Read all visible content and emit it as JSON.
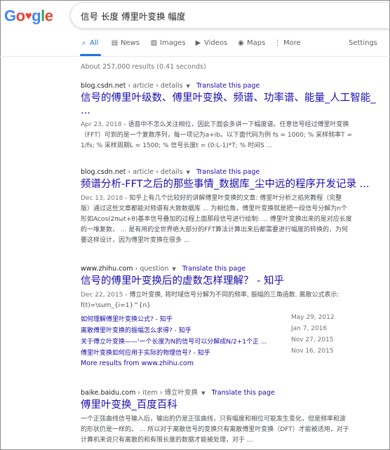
{
  "logo": {
    "text": "Google",
    "letters": [
      "G",
      "o",
      "o",
      "g",
      "l",
      "e"
    ]
  },
  "search": {
    "query": "信号 长度 傅里叶变换 幅度"
  },
  "tabs": [
    {
      "label": "All",
      "icon": "search-icon",
      "active": true
    },
    {
      "label": "News",
      "icon": "news-icon",
      "active": false
    },
    {
      "label": "Images",
      "icon": "image-icon",
      "active": false
    },
    {
      "label": "Videos",
      "icon": "video-icon",
      "active": false
    },
    {
      "label": "Maps",
      "icon": "map-pin-icon",
      "active": false
    },
    {
      "label": "More",
      "icon": "more-dots-icon",
      "active": false
    }
  ],
  "settings_label": "Settings",
  "result_stats": "About 257,000 results (0.41 seconds)",
  "results": [
    {
      "domain": "blog.csdn.net",
      "path": "› article › details",
      "translate": "Translate this page",
      "title_lines": [
        "信号的傅里叶级数、傅里叶变换、频谱、功率谱、能量_人工智能_",
        "..."
      ],
      "date": "Apr 23, 2018",
      "snippet_lines": [
        " - 语音中不怎么关注相位，因此下面会多讲一下幅度谱。任意信号经过傅里叶变换",
        "（FFT）可到的是一个复数序列，每一项记为a+ib。以下面代码为例 fs = 1000; % 采样频率T =",
        "1/fs; % 采样周期L = 1500; % 信号长度t = (0:L-1)*T; % 时间S ..."
      ]
    },
    {
      "domain": "blog.csdn.net",
      "path": "› article › details",
      "translate": "Translate this page",
      "title_lines": [
        "频谱分析-FFT之后的那些事情_数据库_尘中远的程序开发记录 ..."
      ],
      "date": "Dec 13, 2018",
      "snippet_lines": [
        " - 知乎上有几个比较好的讲解傅里叶变换的文章: 傅里叶分析之掐死教程（完整",
        "版）通过这些文章都能对频谱有大致数据库 ... 为相位角，傅里叶变换就是把一段信号分解为n个",
        "形如Acos(2πωt+θ)基本信号叠加的过程上面那段信号进行绘制: ... 傅里叶变换出来的是对应长度",
        "的一堆复数， ... 是有用的全世界绝大部分的FFT算法计算出来后都需要进行幅度的转换的，为何",
        "要这样设计，因为傅里叶变换在很多 ..."
      ]
    },
    {
      "domain": "www.zhihu.com",
      "path": "› question",
      "translate": "Translate this page",
      "title_lines": [
        "信号的傅里叶变换后的虚数怎样理解？ - 知乎"
      ],
      "date": "Dec 22, 2015",
      "snippet_lines": [
        " - 傅立叶变换, 将时域信号分解为不同的频率, 振幅的三角函数. 离散公式表示:",
        "f(t)=\\sum_{i=1}^{n}"
      ],
      "sublinks": [
        {
          "text": "如何理解傅里叶变换公式? - 知乎",
          "date": "May 29, 2012"
        },
        {
          "text": "离散傅里叶变换的振幅怎么求得? - 知乎",
          "date": "Jan 7, 2016"
        },
        {
          "text": "关于傅立叶变换——'一个长度为N的信号可以分解成N/2+1个正 ...",
          "date": "Nov 27, 2015"
        },
        {
          "text": "傅里叶变换如何应用于实际的物理信号? - 知乎",
          "date": "Nov 16, 2015"
        }
      ],
      "more": "More results from www.zhihu.com"
    },
    {
      "domain": "baike.baidu.com",
      "path": "› item › 傅立叶变换",
      "translate": "Translate this page",
      "title_lines": [
        "傅里叶变换_百度百科"
      ],
      "snippet_lines": [
        "一个正弦曲线信号输入后，输出的仍是正弦曲线，只有幅度和相位可能发生变化，但是频率和波",
        "的形状仍是一样的。 ... 所以对于离散信号的变换只有离散傅里叶变换（DFT）才能被适用，对于",
        "计算机来说只有离散的和有限长度的数据才能被处理，对于 ..."
      ]
    }
  ],
  "colors": {
    "link": "#1a0dab",
    "accent": "#1a73e8",
    "gray": "#70757a"
  }
}
